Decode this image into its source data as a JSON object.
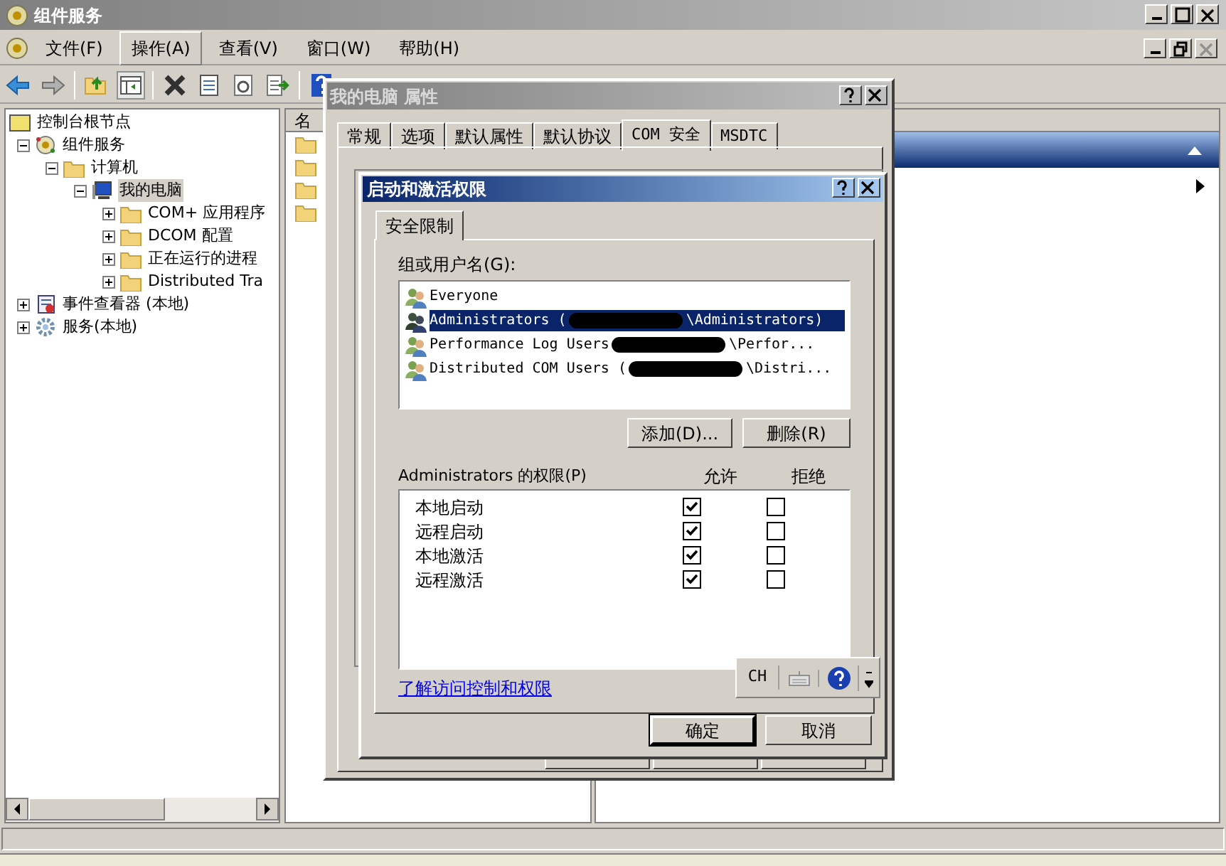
{
  "window": {
    "title": "组件服务"
  },
  "menu": [
    {
      "label": "文件(F)",
      "selected": false
    },
    {
      "label": "操作(A)",
      "selected": true
    },
    {
      "label": "查看(V)",
      "selected": false
    },
    {
      "label": "窗口(W)",
      "selected": false
    },
    {
      "label": "帮助(H)",
      "selected": false
    }
  ],
  "tree": {
    "label": "控制台根节点",
    "kind": "root",
    "children": [
      {
        "label": "组件服务",
        "kind": "services",
        "expanded": true,
        "selected": false,
        "children": [
          {
            "label": "计算机",
            "kind": "folder",
            "expanded": true,
            "selected": false,
            "children": [
              {
                "label": "我的电脑",
                "kind": "computer",
                "expanded": true,
                "selected": true,
                "children": [
                  {
                    "label": "COM+ 应用程序",
                    "kind": "folder",
                    "expanded": false,
                    "selected": false
                  },
                  {
                    "label": "DCOM 配置",
                    "kind": "folder",
                    "expanded": false,
                    "selected": false
                  },
                  {
                    "label": "正在运行的进程",
                    "kind": "folder",
                    "expanded": false,
                    "selected": false
                  },
                  {
                    "label": "Distributed Tra",
                    "kind": "folder",
                    "expanded": false,
                    "selected": false
                  }
                ]
              }
            ]
          }
        ]
      },
      {
        "label": "事件查看器 (本地)",
        "kind": "event",
        "expanded": false,
        "selected": false
      },
      {
        "label": "服务(本地)",
        "kind": "gear",
        "expanded": false,
        "selected": false
      }
    ]
  },
  "middle_list": {
    "header": "名",
    "items": [
      {
        "kind": "folder"
      },
      {
        "kind": "folder"
      },
      {
        "kind": "folder"
      },
      {
        "kind": "folder"
      }
    ]
  },
  "properties_dialog": {
    "title": "我的电脑 属性",
    "tabs": [
      {
        "label": "常规",
        "selected": false
      },
      {
        "label": "选项",
        "selected": false
      },
      {
        "label": "默认属性",
        "selected": false
      },
      {
        "label": "默认协议",
        "selected": false
      },
      {
        "label": "COM 安全",
        "selected": true
      },
      {
        "label": "MSDTC",
        "selected": false
      }
    ]
  },
  "permissions_dialog": {
    "title": "启动和激活权限",
    "tab": "安全限制",
    "users_label": "组或用户名(G):",
    "users": [
      {
        "name": "Everyone",
        "selected": false
      },
      {
        "name": "Administrators (",
        "redacted": true,
        "after": "\\Administrators)",
        "selected": true
      },
      {
        "name": "Performance Log Users",
        "redacted": true,
        "after": "\\Perfor...",
        "selected": false
      },
      {
        "name": "Distributed COM Users (",
        "redacted": true,
        "after": "\\Distri...",
        "selected": false
      }
    ],
    "add_button": "添加(D)...",
    "remove_button": "删除(R)",
    "permissions_label": "Administrators 的权限(P)",
    "allow_header": "允许",
    "deny_header": "拒绝",
    "permissions": [
      {
        "label": "本地启动",
        "allow": true,
        "deny": false
      },
      {
        "label": "远程启动",
        "allow": true,
        "deny": false
      },
      {
        "label": "本地激活",
        "allow": true,
        "deny": false
      },
      {
        "label": "远程激活",
        "allow": true,
        "deny": false
      }
    ],
    "link": "了解访问控制和权限",
    "ok_button": "确定",
    "cancel_button": "取消"
  },
  "language_bar": {
    "language": "CH"
  }
}
